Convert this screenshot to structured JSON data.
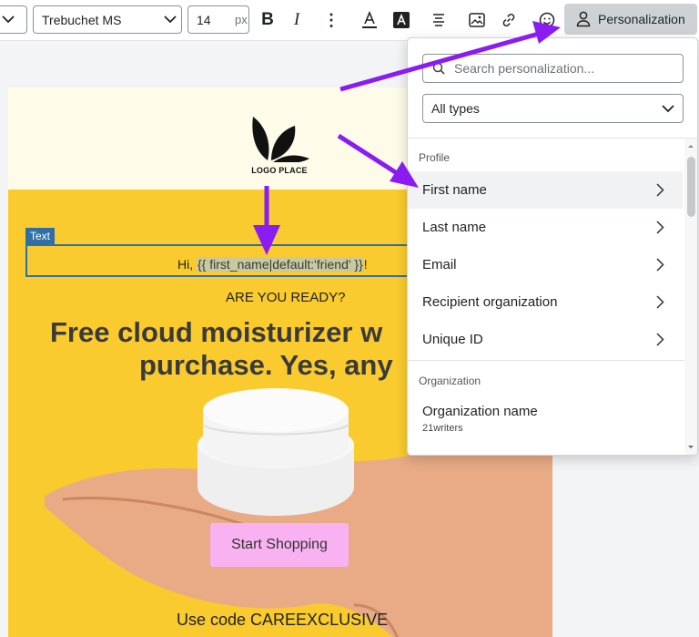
{
  "toolbar": {
    "font_family": "Trebuchet MS",
    "font_size": "14",
    "font_unit": "px",
    "bold_label": "B",
    "italic_label": "I",
    "more_label": "⋮",
    "personalization_label": "Personalization"
  },
  "email": {
    "logo_text": "LOGO PLACE",
    "text_tag": "Text",
    "greeting_prefix": "Hi, ",
    "merge_tag": "{{ first_name|default:'friend' }}",
    "greeting_suffix": "!",
    "ready": "ARE YOU READY?",
    "headline_line1": "Free cloud moisturizer w",
    "headline_line2": "purchase. Yes, any",
    "cta": "Start Shopping",
    "code": "Use code CAREEXCLUSIVE"
  },
  "panel": {
    "search_placeholder": "Search personalization...",
    "type_filter": "All types",
    "sections": [
      {
        "title": "Profile",
        "items": [
          "First name",
          "Last name",
          "Email",
          "Recipient organization",
          "Unique ID"
        ]
      },
      {
        "title": "Organization",
        "items": [
          {
            "name": "Organization name",
            "value": "21writers"
          }
        ]
      }
    ]
  },
  "colors": {
    "accent_arrow": "#8a1cf2",
    "selection_blue": "#2e6fa8",
    "email_yellow": "#f9cb2e",
    "cta_pink": "#f9b2f1"
  }
}
